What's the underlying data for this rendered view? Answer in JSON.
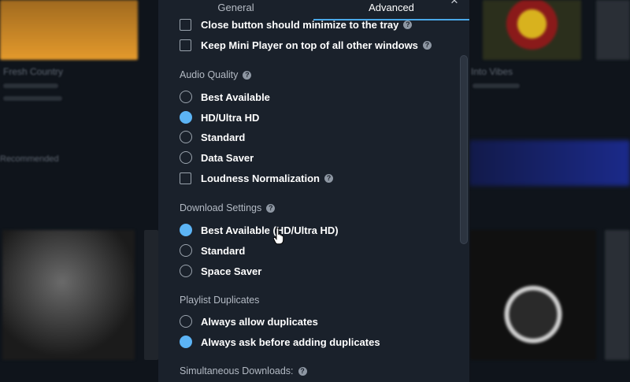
{
  "background": {
    "texts": [
      "Fresh Country",
      "Into Vibes",
      "Recommended"
    ]
  },
  "dialog": {
    "tabs": {
      "general": "General",
      "advanced": "Advanced"
    },
    "close_glyph": "×",
    "window_options": [
      {
        "label": "Close button should minimize to the tray",
        "checked": false,
        "help": true
      },
      {
        "label": "Keep Mini Player on top of all other windows",
        "checked": false,
        "help": true
      }
    ],
    "audio_quality": {
      "title": "Audio Quality",
      "options": [
        {
          "label": "Best Available",
          "selected": false
        },
        {
          "label": "HD/Ultra HD",
          "selected": true
        },
        {
          "label": "Standard",
          "selected": false
        },
        {
          "label": "Data Saver",
          "selected": false
        }
      ],
      "loudness": {
        "label": "Loudness Normalization",
        "checked": false
      }
    },
    "download_settings": {
      "title": "Download Settings",
      "options": [
        {
          "label": "Best Available (HD/Ultra HD)",
          "selected": true
        },
        {
          "label": "Standard",
          "selected": false
        },
        {
          "label": "Space Saver",
          "selected": false
        }
      ]
    },
    "playlist_duplicates": {
      "title": "Playlist Duplicates",
      "options": [
        {
          "label": "Always allow duplicates",
          "selected": false
        },
        {
          "label": "Always ask before adding duplicates",
          "selected": true
        }
      ]
    },
    "simultaneous_downloads": {
      "title": "Simultaneous Downloads:"
    },
    "help_glyph": "?"
  },
  "colors": {
    "accent": "#5cb4f5",
    "tab_underline": "#4aa8e8",
    "dialog_bg": "#1a212b"
  }
}
